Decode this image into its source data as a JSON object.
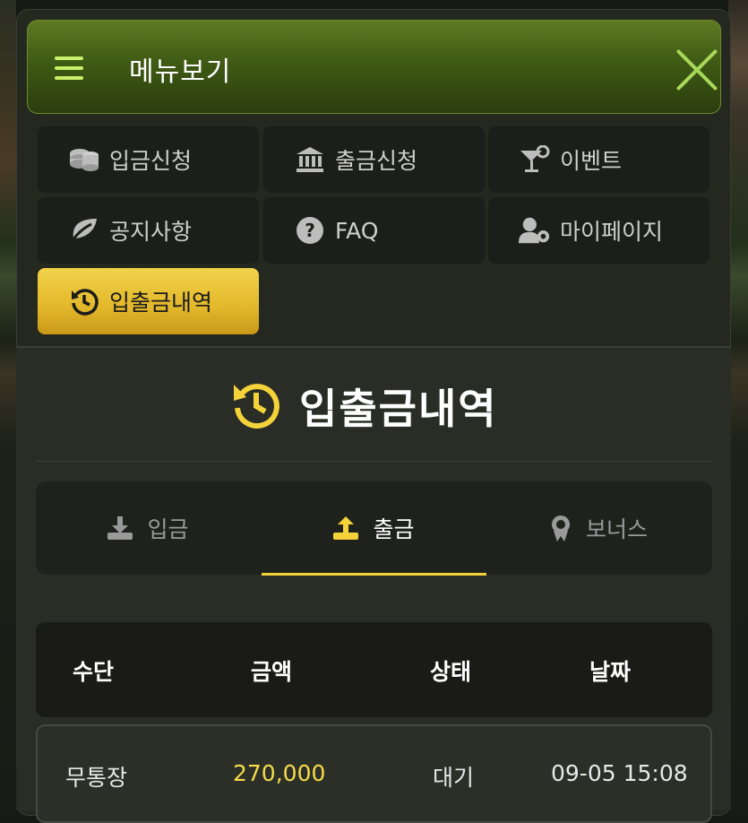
{
  "header": {
    "title": "메뉴보기"
  },
  "menu": [
    {
      "label": "입금신청",
      "icon": "coins-icon"
    },
    {
      "label": "출금신청",
      "icon": "bank-icon"
    },
    {
      "label": "이벤트",
      "icon": "cocktail-icon"
    },
    {
      "label": "공지사항",
      "icon": "leaf-icon"
    },
    {
      "label": "FAQ",
      "icon": "question-circle-icon"
    },
    {
      "label": "마이페이지",
      "icon": "user-gear-icon"
    },
    {
      "label": "입출금내역",
      "icon": "history-icon",
      "active": true
    }
  ],
  "page": {
    "title": "입출금내역"
  },
  "tabs": [
    {
      "label": "입금",
      "icon": "download-icon"
    },
    {
      "label": "출금",
      "icon": "upload-icon",
      "active": true
    },
    {
      "label": "보너스",
      "icon": "award-icon"
    }
  ],
  "table": {
    "headers": [
      "수단",
      "금액",
      "상태",
      "날짜"
    ],
    "rows": [
      {
        "method": "무통장",
        "amount": "270,000",
        "status": "대기",
        "date": "09-05 15:08"
      }
    ]
  },
  "colors": {
    "accent": "#f4d23a",
    "header_green": "#4a6a18",
    "close": "#a7d85a"
  }
}
